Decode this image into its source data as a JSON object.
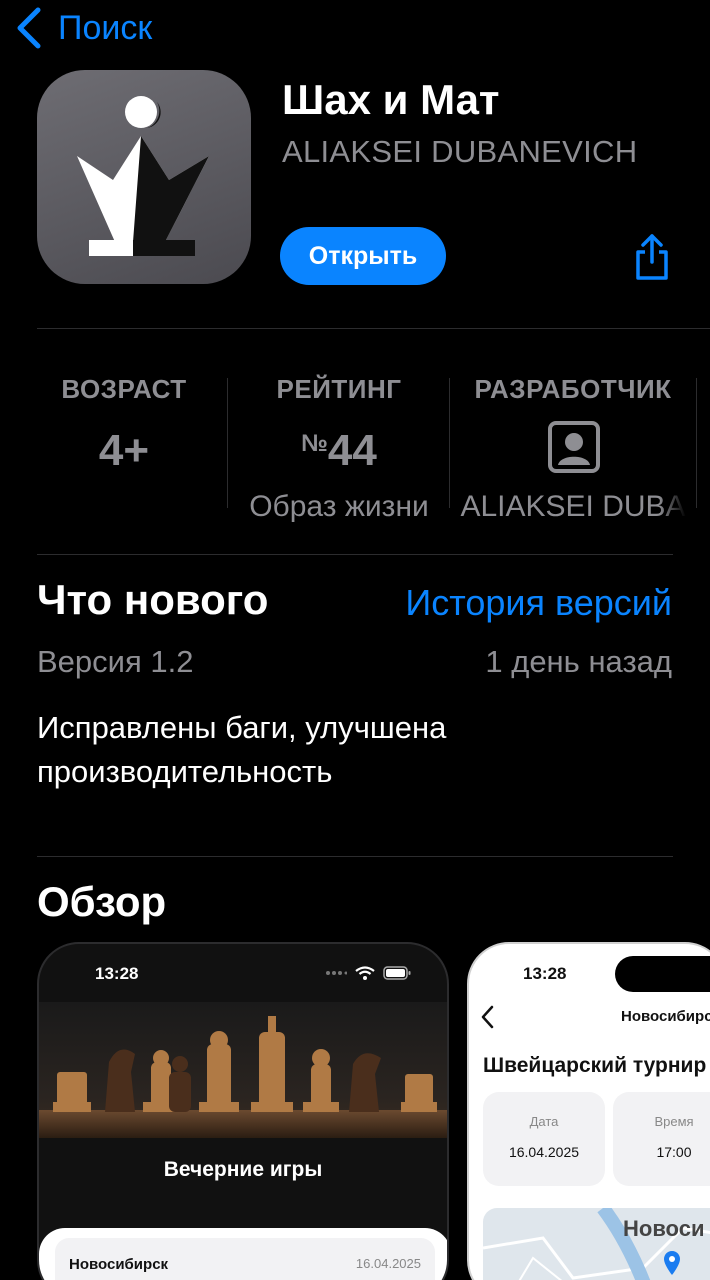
{
  "nav": {
    "back_label": "Поиск"
  },
  "app": {
    "title": "Шах и Мат",
    "developer": "ALIAKSEI DUBANEVICH",
    "open_label": "Открыть"
  },
  "stats": {
    "age": {
      "label": "ВОЗРАСТ",
      "value": "4+"
    },
    "rating": {
      "label": "РЕЙТИНГ",
      "prefix": "№",
      "value": "44",
      "sub": "Образ жизни"
    },
    "developer": {
      "label": "РАЗРАБОТЧИК",
      "sub": "ALIAKSEI DUBA"
    }
  },
  "whats_new": {
    "title": "Что нового",
    "history_link": "История версий",
    "version": "Версия 1.2",
    "date": "1 день назад",
    "notes": "Исправлены баги, улучшена производительность"
  },
  "overview": {
    "title": "Обзор",
    "shot1": {
      "time": "13:28",
      "screen_title": "Вечерние игры",
      "card_city": "Новосибирск",
      "card_date": "16.04.2025"
    },
    "shot2": {
      "time": "13:28",
      "nav_title": "Новосибирс",
      "screen_title": "Швейцарский турнир",
      "tiles": [
        {
          "label": "Дата",
          "value": "16.04.2025"
        },
        {
          "label": "Время",
          "value": "17:00"
        }
      ],
      "map_label": "Новоси"
    }
  },
  "colors": {
    "accent": "#0a84ff",
    "secondary_text": "#8e8e93",
    "background": "#000000"
  }
}
